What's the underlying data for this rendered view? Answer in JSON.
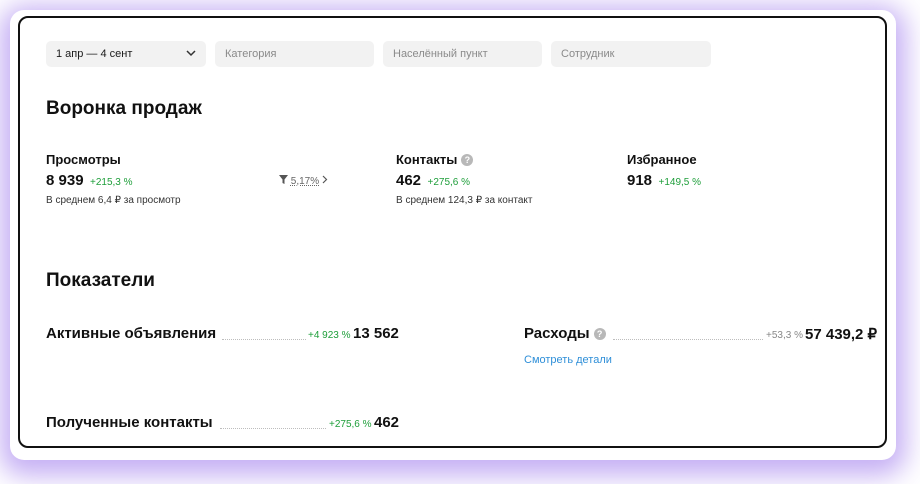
{
  "filters": {
    "date": "1 апр — 4 сент",
    "category_placeholder": "Категория",
    "city_placeholder": "Населённый пункт",
    "employee_placeholder": "Сотрудник"
  },
  "funnel": {
    "title": "Воронка продаж",
    "views": {
      "label": "Просмотры",
      "value": "8 939",
      "delta": "+215,3 %",
      "note": "В среднем 6,4 ₽ за просмотр"
    },
    "conversion": "5,17%",
    "contacts": {
      "label": "Контакты",
      "value": "462",
      "delta": "+275,6 %",
      "note": "В среднем 124,3 ₽ за контакт"
    },
    "favorites": {
      "label": "Избранное",
      "value": "918",
      "delta": "+149,5 %"
    }
  },
  "metrics": {
    "title": "Показатели",
    "active_ads": {
      "label": "Активные объявления",
      "delta": "+4 923 %",
      "value": "13 562"
    },
    "expenses": {
      "label": "Расходы",
      "delta": "+53,3 %",
      "value": "57 439,2 ₽",
      "link": "Смотреть детали"
    },
    "contacts_received": {
      "label": "Полученные контакты",
      "delta": "+275,6 %",
      "value": "462"
    }
  },
  "icons": [
    "chevron-down-icon",
    "filter-funnel-icon",
    "chevron-right-icon",
    "help-icon"
  ],
  "colors": {
    "positive": "#1e9e3a",
    "link": "#2f8fd8",
    "glow": "#966eeb"
  }
}
